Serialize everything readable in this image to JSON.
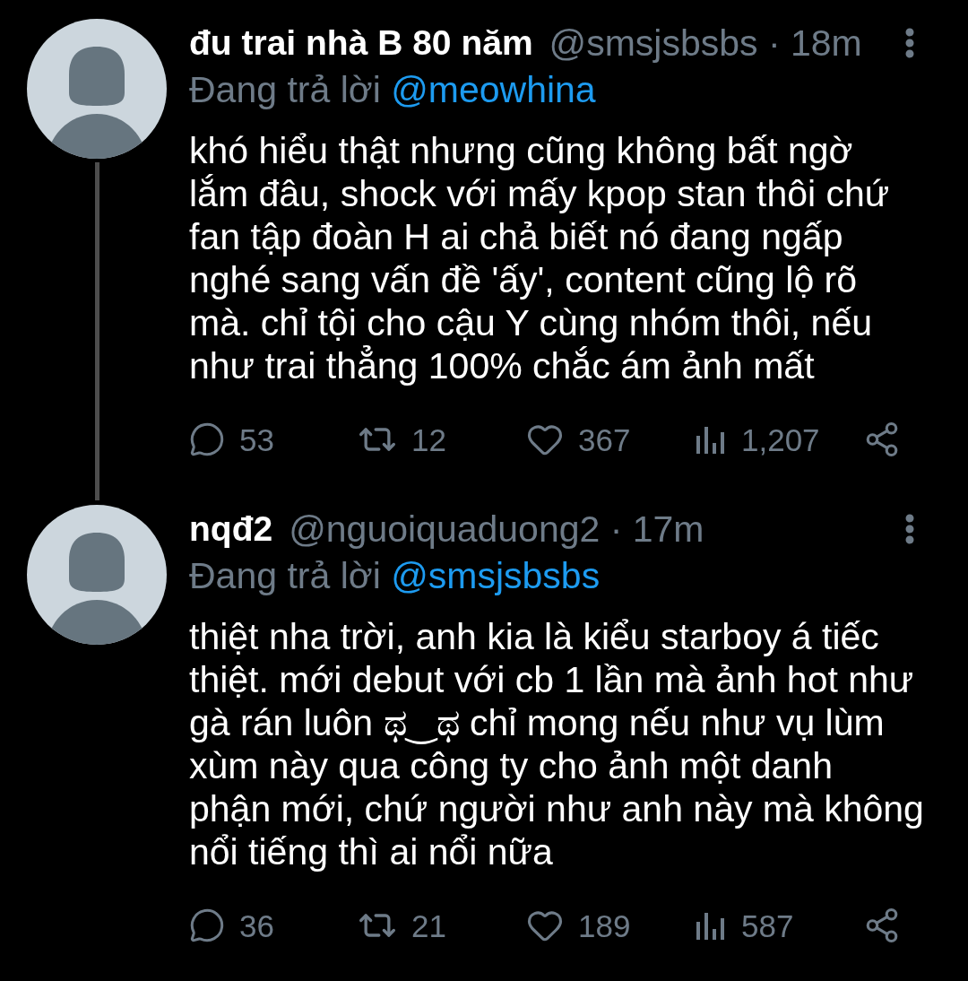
{
  "tweets": [
    {
      "display_name": "đu trai nhà B 80 năm",
      "handle_and_time": "@smsjsbsbs · 18m",
      "reply_label": "Đang trả lời",
      "reply_to": "@meowhina",
      "text": "khó hiểu thật nhưng cũng không bất ngờ\nlắm đâu, shock với mấy kpop stan thôi chứ\nfan tập đoàn H ai chả biết nó đang ngấp\nnghé sang vấn đề 'ấy', content cũng lộ rõ\nmà. chỉ tội cho cậu Y cùng nhóm thôi, nếu\nnhư trai thẳng 100% chắc ám ảnh mất",
      "thread_continues": true,
      "actions": [
        {
          "kind": "reply",
          "count": "53"
        },
        {
          "kind": "retweet",
          "count": "12"
        },
        {
          "kind": "like",
          "count": "367"
        },
        {
          "kind": "views",
          "count": "1,207"
        },
        {
          "kind": "share"
        }
      ]
    },
    {
      "display_name": "nqđ2",
      "handle_and_time": "@nguoiquaduong2 · 17m",
      "reply_label": "Đang trả lời",
      "reply_to": "@smsjsbsbs",
      "text": "thiệt nha trời, anh kia là kiểu starboy á tiếc\nthiệt. mới debut với cb 1 lần mà ảnh hot như\ngà rán luôn ಥ‿ಥ chỉ mong nếu như vụ lùm\nxùm này qua công ty cho ảnh một danh\nphận mới, chứ người như anh này mà không\nnổi tiếng thì ai nổi nữa",
      "thread_continues": false,
      "actions": [
        {
          "kind": "reply",
          "count": "36"
        },
        {
          "kind": "retweet",
          "count": "21"
        },
        {
          "kind": "like",
          "count": "189"
        },
        {
          "kind": "views",
          "count": "587"
        },
        {
          "kind": "share"
        }
      ]
    }
  ]
}
